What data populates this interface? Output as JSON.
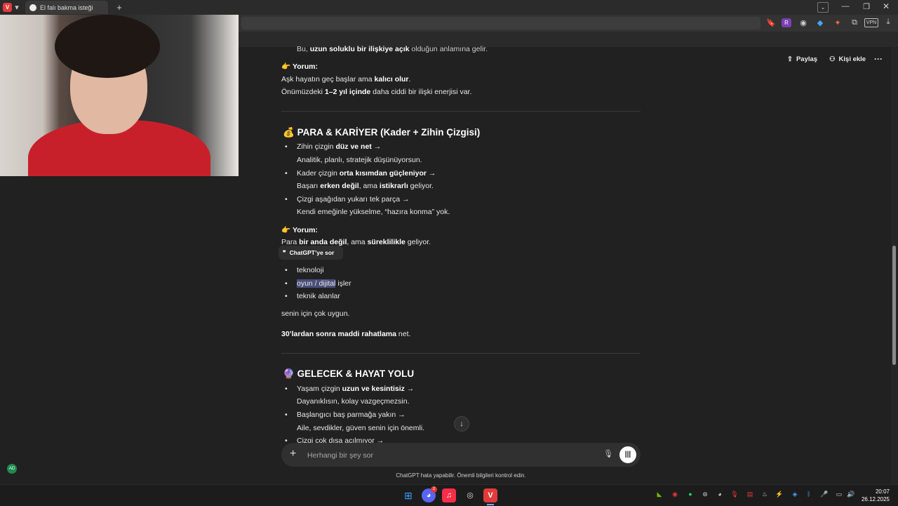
{
  "browser": {
    "tab_title": "El falı bakma isteği",
    "new_tab": "+",
    "menu_icon": "vivaldi-icon",
    "vpn_label": "VPN"
  },
  "page": {
    "share_label": "Paylaş",
    "add_person_label": "Kişi ekle",
    "more_label": "···",
    "top_cut_line": {
      "pre": "Bu, ",
      "bold": "uzun soluklu bir ilişkiye açık",
      "post": " olduğun anlamına gelir."
    },
    "love_comment": {
      "label": "Yorum:",
      "line1_pre": "Aşk hayatın geç başlar ama ",
      "line1_bold": "kalıcı olur",
      "line1_post": ".",
      "line2_pre": "Önümüzdeki ",
      "line2_bold": "1–2 yıl içinde",
      "line2_post": " daha ciddi bir ilişki enerjisi var."
    },
    "money_section": {
      "title": "PARA & KARİYER (Kader + Zihin Çizgisi)",
      "items": [
        {
          "pre": "Zihin çizgin ",
          "bold": "düz ve net",
          "post": " →",
          "sub_pre": "Analitik, planlı, stratejik düşünüyorsun.",
          "sub_bold": "",
          "sub_mid": "",
          "sub_bold2": "",
          "sub_post": ""
        },
        {
          "pre": "Kader çizgin ",
          "bold": "orta kısımdan güçleniyor",
          "post": " →",
          "sub_pre": "Başarı ",
          "sub_bold": "erken değil",
          "sub_mid": ", ama ",
          "sub_bold2": "istikrarlı",
          "sub_post": " geliyor."
        },
        {
          "pre": "Çizgi aşağıdan yukarı tek parça →",
          "bold": "",
          "post": "",
          "sub_pre": "Kendi emeğinle yükselme, “hazıra konma” yok.",
          "sub_bold": "",
          "sub_mid": "",
          "sub_bold2": "",
          "sub_post": ""
        }
      ],
      "comment_label": "Yorum:",
      "comment_pre": "Para ",
      "comment_bold": "bir anda değil",
      "comment_mid": ", ama ",
      "comment_bold2": "süreklilikle",
      "comment_post": " geliyor.",
      "fields": [
        "teknoloji",
        "işler",
        "teknik alanlar"
      ],
      "field2_selected": "oyun / dijital",
      "suitable": "senin için çok uygun.",
      "thirties_bold": "30’lardan sonra maddi rahatlama",
      "thirties_post": " net."
    },
    "ask_bubble": "ChatGPT’ye sor",
    "future_section": {
      "title": "GELECEK & HAYAT YOLU",
      "items": [
        {
          "pre": "Yaşam çizgin ",
          "bold": "uzun ve kesintisiz",
          "post": " →",
          "sub": "Dayanıklısın, kolay vazgeçmezsin."
        },
        {
          "pre": "Başlangıcı baş parmağa yakın →",
          "bold": "",
          "post": "",
          "sub": "Aile, sevdikler, güven senin için önemli."
        },
        {
          "pre": "Çizgi çok dışa açılmıyor →",
          "bold": "",
          "post": "",
          "sub": ""
        }
      ]
    },
    "composer_placeholder": "Herhangi bir şey sor",
    "disclaimer": "ChatGPT hata yapabilir. Önemli bilgileri kontrol edin."
  },
  "taskbar": {
    "discord_badge": "2",
    "time": "20:07",
    "date": "26.12.2025",
    "avatar_initials": "AD"
  }
}
